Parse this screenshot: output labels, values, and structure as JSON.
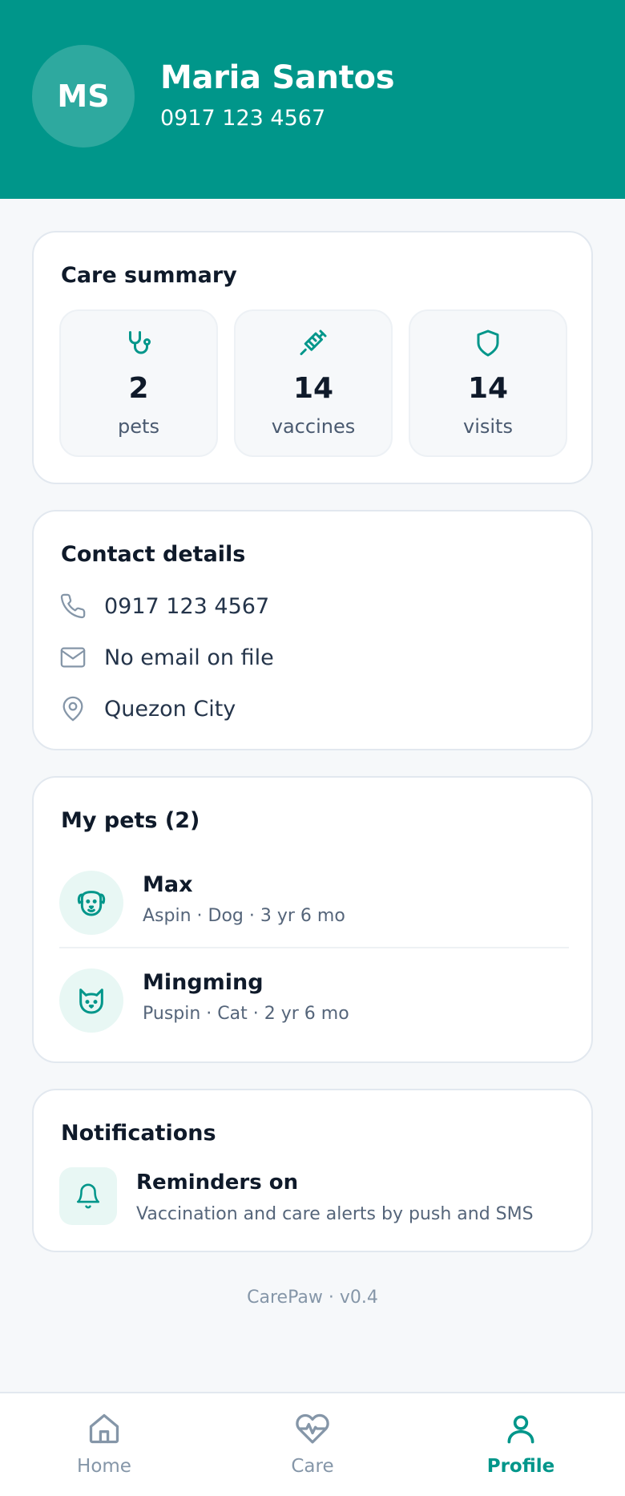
{
  "header": {
    "initials": "MS",
    "name": "Maria Santos",
    "phone": "0917 123 4567"
  },
  "summary": {
    "title": "Care summary",
    "stats": [
      {
        "icon": "stethoscope-icon",
        "value": "2",
        "label": "pets"
      },
      {
        "icon": "syringe-icon",
        "value": "14",
        "label": "vaccines"
      },
      {
        "icon": "shield-icon",
        "value": "14",
        "label": "visits"
      }
    ]
  },
  "contact": {
    "title": "Contact details",
    "phone": "0917 123 4567",
    "email": "No email on file",
    "location": "Quezon City"
  },
  "pets": {
    "title": "My pets (2)",
    "items": [
      {
        "name": "Max",
        "meta": "Aspin · Dog · 3 yr 6 mo",
        "icon": "dog-icon"
      },
      {
        "name": "Mingming",
        "meta": "Puspin · Cat · 2 yr 6 mo",
        "icon": "cat-icon"
      }
    ]
  },
  "notifications": {
    "title": "Notifications",
    "status": "Reminders on",
    "description": "Vaccination and care alerts by push and SMS"
  },
  "footer": {
    "version": "CarePaw · v0.4"
  },
  "nav": {
    "items": [
      {
        "label": "Home",
        "icon": "home-icon"
      },
      {
        "label": "Care",
        "icon": "heart-pulse-icon"
      },
      {
        "label": "Profile",
        "icon": "user-icon",
        "active": true
      }
    ]
  },
  "colors": {
    "brand": "#00968a",
    "background": "#f6f8fa",
    "muted": "#8596a8"
  }
}
